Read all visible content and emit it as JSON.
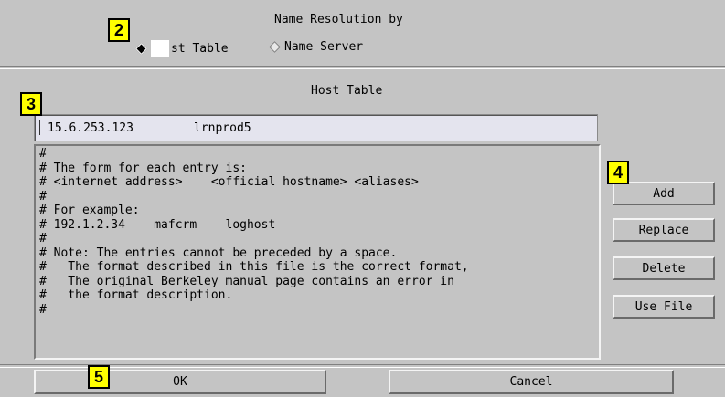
{
  "resolution": {
    "title": "Name Resolution by",
    "option_host_visible": "st Table",
    "option_nameserver": "Name Server",
    "selected": "Host Table"
  },
  "host_table": {
    "title": "Host Table",
    "entry": {
      "address": "15.6.253.123",
      "hostname": "lrnprod5"
    },
    "file_lines": [
      "#",
      "# The form for each entry is:",
      "# <internet address>    <official hostname> <aliases>",
      "#",
      "# For example:",
      "# 192.1.2.34    mafcrm    loghost",
      "#",
      "# Note: The entries cannot be preceded by a space.",
      "#   The format described in this file is the correct format,",
      "#   The original Berkeley manual page contains an error in",
      "#   the format description.",
      "#"
    ]
  },
  "buttons": {
    "add": "Add",
    "replace": "Replace",
    "delete": "Delete",
    "use_file": "Use File",
    "ok": "OK",
    "cancel": "Cancel"
  },
  "callouts": {
    "c2": "2",
    "c3": "3",
    "c4": "4",
    "c5": "5"
  }
}
